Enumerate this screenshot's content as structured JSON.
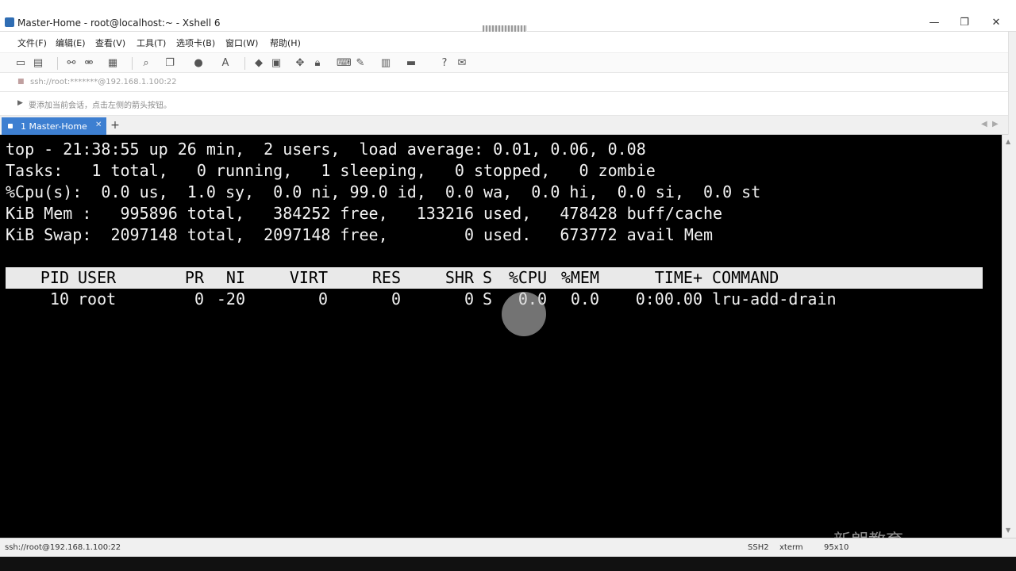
{
  "window": {
    "title": "Master-Home - root@localhost:~ - Xshell 6",
    "minimize": "—",
    "maximize": "❐",
    "close": "✕"
  },
  "menu": {
    "items": [
      "文件(F)",
      "编辑(E)",
      "查看(V)",
      "工具(T)",
      "选项卡(B)",
      "窗口(W)",
      "帮助(H)"
    ]
  },
  "address": {
    "text": "ssh://root:*******@192.168.1.100:22"
  },
  "hint": {
    "text": "要添加当前会话，点击左侧的箭头按钮。"
  },
  "tabs": {
    "active": {
      "label": "1 Master-Home",
      "close": "✕"
    },
    "new_tab": "+"
  },
  "terminal": {
    "lines": [
      "top - 21:38:55 up 26 min,  2 users,  load average: 0.01, 0.06, 0.08",
      "Tasks:   1 total,   0 running,   1 sleeping,   0 stopped,   0 zombie",
      "%Cpu(s):  0.0 us,  1.0 sy,  0.0 ni, 99.0 id,  0.0 wa,  0.0 hi,  0.0 si,  0.0 st",
      "KiB Mem :   995896 total,   384252 free,   133216 used,   478428 buff/cache",
      "KiB Swap:  2097148 total,  2097148 free,        0 used.   673772 avail Mem"
    ],
    "columns": [
      "PID",
      "USER",
      "PR",
      "NI",
      "VIRT",
      "RES",
      "SHR",
      "S",
      "%CPU",
      "%MEM",
      "TIME+",
      "COMMAND"
    ],
    "process": [
      "10",
      "root",
      "0",
      "-20",
      "0",
      "0",
      "0",
      "S",
      "0.0",
      "0.0",
      "0:00.00",
      "lru-add-drain"
    ]
  },
  "status": {
    "connection": "ssh://root@192.168.1.100:22",
    "protocol": "SSH2",
    "term": "xterm",
    "size": "95x10"
  },
  "watermark": "新朗教育"
}
